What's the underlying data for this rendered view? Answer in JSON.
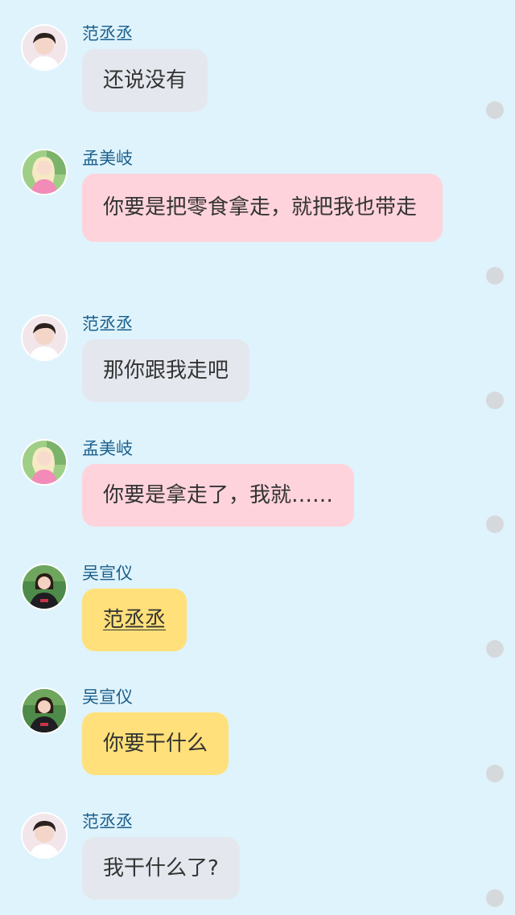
{
  "messages": [
    {
      "sender": "范丞丞",
      "text": "还说没有",
      "bubble_color": "#e4e8ee",
      "avatar": "fan-chengcheng-avatar"
    },
    {
      "sender": "孟美岐",
      "text": "你要是把零食拿走，就把我也带走",
      "bubble_color": "#ffd3dc",
      "avatar": "meng-meiqi-avatar"
    },
    {
      "sender": "范丞丞",
      "text": "那你跟我走吧",
      "bubble_color": "#e4e8ee",
      "avatar": "fan-chengcheng-avatar"
    },
    {
      "sender": "孟美岐",
      "text": "你要是拿走了，我就……",
      "bubble_color": "#ffd3dc",
      "avatar": "meng-meiqi-avatar"
    },
    {
      "sender": "吴宣仪",
      "text": "范丞丞",
      "bubble_color": "#ffe07a",
      "avatar": "wu-xuanyi-avatar"
    },
    {
      "sender": "吴宣仪",
      "text": "你要干什么",
      "bubble_color": "#ffe07a",
      "avatar": "wu-xuanyi-avatar"
    },
    {
      "sender": "范丞丞",
      "text": "我干什么了?",
      "bubble_color": "#e4e8ee",
      "avatar": "fan-chengcheng-avatar"
    }
  ],
  "status_icon": "read-status-dot"
}
